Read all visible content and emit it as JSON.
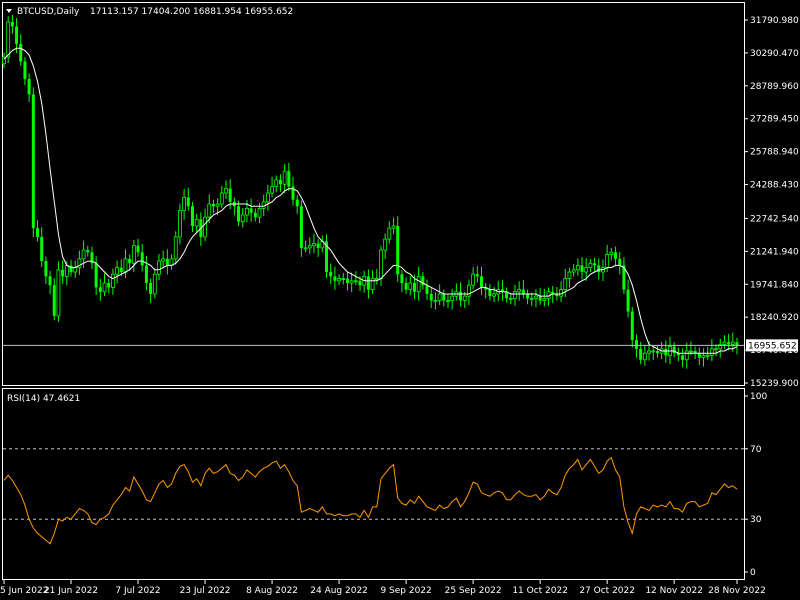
{
  "colors": {
    "background": "#000000",
    "frame": "#ffffff",
    "candle_bull": "#00ff00",
    "candle_bear": "#00ff00",
    "ma_line": "#ffffff",
    "rsi_line": "#ff9900",
    "price_line": "#c0c0c0",
    "level_lines": "#c0c0c0"
  },
  "main_header": {
    "menu_icon": "triangle-down-icon",
    "symbol": "BTCUSD,Daily",
    "ohlc": "17113.157 17404.200 16881.954 16955.652"
  },
  "rsi_header": {
    "text": "RSI(14) 47.4621"
  },
  "current_price_label": "16955.652",
  "chart_data": [
    {
      "type": "candlestick",
      "symbol": "BTCUSD",
      "timeframe": "Daily",
      "ylim": [
        15239.9,
        31790.98
      ],
      "y_ticks": [
        "31790.980",
        "30290.470",
        "28789.960",
        "27289.450",
        "25788.940",
        "24288.430",
        "22742.540",
        "21241.940",
        "19741.840",
        "18240.920",
        "16740.410",
        "15239.900"
      ],
      "x_ticks": [
        "5 Jun 2022",
        "21 Jun 2022",
        "7 Jul 2022",
        "23 Jul 2022",
        "8 Aug 2022",
        "24 Aug 2022",
        "9 Sep 2022",
        "25 Sep 2022",
        "11 Oct 2022",
        "27 Oct 2022",
        "12 Nov 2022",
        "28 Nov 2022"
      ],
      "current_price": 16955.652,
      "close_series": [
        30100,
        31700,
        31500,
        30700,
        29900,
        29100,
        28400,
        22300,
        21900,
        20800,
        20100,
        19700,
        18300,
        20400,
        20100,
        20600,
        20300,
        20500,
        20900,
        21300,
        21200,
        20700,
        19600,
        19400,
        19800,
        19600,
        20200,
        20500,
        20300,
        20900,
        20700,
        21500,
        21200,
        20600,
        19800,
        19300,
        20200,
        20800,
        20900,
        20600,
        20900,
        21900,
        23100,
        23700,
        23300,
        22400,
        22700,
        21900,
        22800,
        23400,
        23300,
        23400,
        23900,
        24100,
        23500,
        23300,
        22600,
        22900,
        23200,
        23000,
        22800,
        23200,
        23500,
        23900,
        24200,
        24500,
        24300,
        24900,
        24200,
        23600,
        23300,
        21400,
        21400,
        21500,
        21600,
        21400,
        21700,
        20300,
        20100,
        19900,
        20000,
        20000,
        19800,
        19900,
        19900,
        19700,
        20100,
        19500,
        20000,
        20000,
        21300,
        21800,
        22300,
        22400,
        20200,
        19800,
        19500,
        19800,
        19400,
        20100,
        19700,
        19300,
        19000,
        19000,
        19300,
        19000,
        19000,
        19200,
        19400,
        19000,
        19200,
        19700,
        20200,
        20100,
        19600,
        19500,
        19200,
        19300,
        19500,
        19400,
        19100,
        19100,
        19400,
        19500,
        19300,
        19100,
        19100,
        19200,
        19000,
        19100,
        19400,
        19300,
        19200,
        19500,
        20000,
        20300,
        20400,
        20600,
        20300,
        20500,
        20700,
        20600,
        20300,
        20500,
        21100,
        21200,
        20900,
        20600,
        19500,
        18500,
        17200,
        16800,
        16300,
        16600,
        16700,
        16700,
        16600,
        16800,
        16500,
        16900,
        16600,
        16500,
        16300,
        16700,
        16700,
        16600,
        16400,
        16500,
        16500,
        16800,
        16800,
        17000,
        17100,
        17000,
        17100,
        16955
      ],
      "ma_series": [
        30000,
        30200,
        30400,
        30500,
        30500,
        30400,
        30200,
        29700,
        29000,
        28000,
        26600,
        25000,
        23500,
        22000,
        21000,
        20600,
        20500,
        20500,
        20600,
        20700,
        20800,
        20800,
        20700,
        20500,
        20300,
        20100,
        20000,
        20100,
        20200,
        20300,
        20400,
        20600,
        20800,
        20800,
        20700,
        20600,
        20400,
        20400,
        20500,
        20600,
        20600,
        20700,
        20900,
        21200,
        21600,
        21900,
        22100,
        22300,
        22500,
        22700,
        22900,
        23000,
        23100,
        23300,
        23400,
        23400,
        23400,
        23400,
        23400,
        23300,
        23300,
        23300,
        23300,
        23400,
        23500,
        23700,
        23800,
        24000,
        24100,
        24100,
        24000,
        23700,
        23300,
        22800,
        22300,
        21900,
        21700,
        21500,
        21300,
        21000,
        20700,
        20500,
        20300,
        20200,
        20100,
        20000,
        19900,
        19900,
        19900,
        19900,
        20000,
        20200,
        20400,
        20600,
        20600,
        20500,
        20300,
        20200,
        20000,
        19900,
        19800,
        19700,
        19600,
        19500,
        19400,
        19300,
        19300,
        19300,
        19300,
        19300,
        19300,
        19300,
        19400,
        19500,
        19600,
        19600,
        19500,
        19500,
        19400,
        19400,
        19400,
        19300,
        19300,
        19300,
        19300,
        19300,
        19300,
        19300,
        19200,
        19200,
        19200,
        19300,
        19300,
        19300,
        19400,
        19500,
        19600,
        19800,
        19900,
        20000,
        20200,
        20300,
        20400,
        20400,
        20500,
        20500,
        20600,
        20600,
        20500,
        20200,
        19700,
        19000,
        18200,
        17500,
        17000,
        16900,
        16800,
        16700,
        16700,
        16700,
        16700,
        16600,
        16600,
        16600,
        16600,
        16600,
        16600,
        16600,
        16600,
        16600,
        16600,
        16700,
        16700,
        16800,
        16800,
        16900
      ]
    },
    {
      "type": "line",
      "indicator": "RSI(14)",
      "current_value": 47.4621,
      "ylim": [
        0,
        100
      ],
      "y_ticks": [
        100,
        70,
        30,
        0
      ],
      "levels": [
        70,
        30
      ],
      "values": [
        52,
        55,
        52,
        48,
        44,
        38,
        30,
        25,
        22,
        20,
        18,
        16,
        22,
        30,
        29,
        31,
        30,
        33,
        36,
        35,
        33,
        28,
        27,
        30,
        31,
        33,
        38,
        41,
        44,
        48,
        46,
        54,
        50,
        46,
        41,
        40,
        45,
        50,
        52,
        48,
        50,
        56,
        60,
        61,
        57,
        51,
        53,
        49,
        56,
        59,
        56,
        57,
        59,
        61,
        56,
        55,
        52,
        54,
        58,
        56,
        54,
        57,
        59,
        60,
        62,
        63,
        59,
        61,
        57,
        52,
        49,
        34,
        35,
        36,
        35,
        34,
        37,
        33,
        33,
        32,
        33,
        32,
        32,
        33,
        33,
        31,
        35,
        31,
        37,
        37,
        53,
        56,
        59,
        61,
        42,
        39,
        38,
        41,
        39,
        43,
        40,
        37,
        36,
        35,
        38,
        36,
        37,
        40,
        42,
        37,
        40,
        45,
        51,
        50,
        45,
        44,
        43,
        45,
        46,
        45,
        41,
        41,
        44,
        46,
        44,
        43,
        43,
        44,
        41,
        43,
        47,
        45,
        44,
        48,
        55,
        59,
        61,
        64,
        58,
        61,
        64,
        60,
        56,
        58,
        63,
        65,
        58,
        54,
        37,
        28,
        22,
        33,
        37,
        36,
        35,
        38,
        37,
        38,
        37,
        40,
        36,
        36,
        34,
        39,
        40,
        40,
        37,
        38,
        39,
        45,
        44,
        47,
        50,
        48,
        49,
        47
      ]
    }
  ]
}
